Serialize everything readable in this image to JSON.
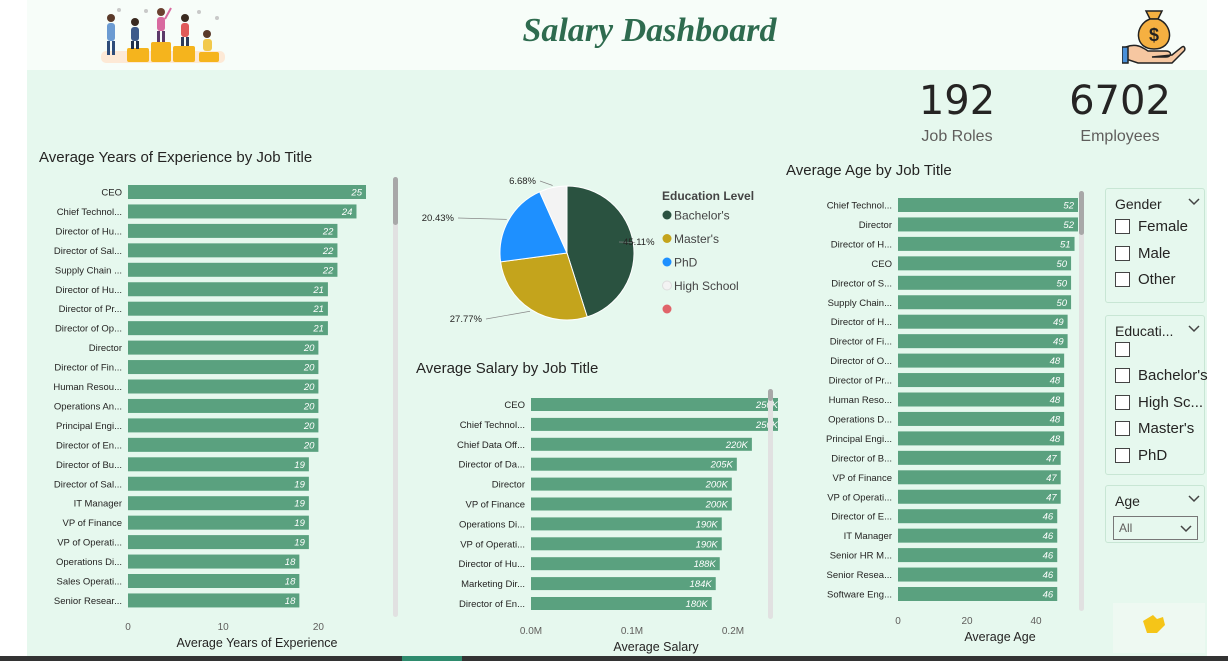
{
  "header": {
    "title": "Salary Dashboard",
    "people_icon": "people-celebrating-icon",
    "money_icon": "money-bag-hand-icon"
  },
  "kpis": [
    {
      "value": "192",
      "label": "Job Roles"
    },
    {
      "value": "6702",
      "label": "Employees"
    }
  ],
  "colors": {
    "bar": "#5aa17f",
    "bachelors": "#2a5240",
    "masters": "#c4a41c",
    "phd": "#1e90ff",
    "high_school": "#f3f3f3",
    "blank": "#e0646a"
  },
  "chart_data": [
    {
      "type": "bar",
      "orientation": "horizontal",
      "title": "Average Years of Experience by Job Title",
      "xlabel": "Average Years of Experience",
      "x_ticks": [
        "0",
        "10",
        "20"
      ],
      "xlim": [
        0,
        25
      ],
      "categories": [
        "CEO",
        "Chief Technol...",
        "Director of Hu...",
        "Director of Sal...",
        "Supply Chain ...",
        "Director of Hu...",
        "Director of Pr...",
        "Director of Op...",
        "Director",
        "Director of Fin...",
        "Human Resou...",
        "Operations An...",
        "Principal Engi...",
        "Director of En...",
        "Director of Bu...",
        "Director of Sal...",
        "IT Manager",
        "VP of Finance",
        "VP of Operati...",
        "Operations Di...",
        "Sales Operati...",
        "Senior Resear..."
      ],
      "values": [
        25,
        24,
        22,
        22,
        22,
        21,
        21,
        21,
        20,
        20,
        20,
        20,
        20,
        20,
        19,
        19,
        19,
        19,
        19,
        18,
        18,
        18
      ],
      "value_labels": [
        "25",
        "24",
        "22",
        "22",
        "22",
        "21",
        "21",
        "21",
        "20",
        "20",
        "20",
        "20",
        "20",
        "20",
        "19",
        "19",
        "19",
        "19",
        "19",
        "18",
        "18",
        "18"
      ]
    },
    {
      "type": "pie",
      "title": "",
      "legend_title": "Education Level",
      "legend_position": "right",
      "labels": [
        "Bachelor's",
        "Master's",
        "PhD",
        "High School",
        ""
      ],
      "values": [
        45.11,
        27.77,
        20.43,
        6.68,
        0
      ],
      "value_labels": [
        "45.11%",
        "27.77%",
        "20.43%",
        "6.68%",
        ""
      ]
    },
    {
      "type": "bar",
      "orientation": "horizontal",
      "title": "Average Salary by Job Title",
      "xlabel": "Average Salary",
      "x_ticks": [
        "0.0M",
        "0.1M",
        "0.2M"
      ],
      "xlim": [
        0,
        250000
      ],
      "categories": [
        "CEO",
        "Chief Technol...",
        "Chief Data Off...",
        "Director of Da...",
        "Director",
        "VP of Finance",
        "Operations Di...",
        "VP of Operati...",
        "Director of Hu...",
        "Marketing Dir...",
        "Director of En..."
      ],
      "values": [
        250000,
        250000,
        220000,
        205000,
        200000,
        200000,
        190000,
        190000,
        188000,
        184000,
        180000
      ],
      "value_labels": [
        "250K",
        "250K",
        "220K",
        "205K",
        "200K",
        "200K",
        "190K",
        "190K",
        "188K",
        "184K",
        "180K"
      ]
    },
    {
      "type": "bar",
      "orientation": "horizontal",
      "title": "Average Age by Job Title",
      "xlabel": "Average Age",
      "x_ticks": [
        "0",
        "20",
        "40"
      ],
      "xlim": [
        0,
        52
      ],
      "categories": [
        "Chief Technol...",
        "Director",
        "Director of H...",
        "CEO",
        "Director of S...",
        "Supply Chain...",
        "Director of H...",
        "Director of Fi...",
        "Director of O...",
        "Director of Pr...",
        "Human Reso...",
        "Operations D...",
        "Principal Engi...",
        "Director of B...",
        "VP of Finance",
        "VP of Operati...",
        "Director of E...",
        "IT Manager",
        "Senior HR M...",
        "Senior Resea...",
        "Software Eng..."
      ],
      "values": [
        52,
        52,
        51,
        50,
        50,
        50,
        49,
        49,
        48,
        48,
        48,
        48,
        48,
        47,
        47,
        47,
        46,
        46,
        46,
        46,
        46
      ],
      "value_labels": [
        "52",
        "52",
        "51",
        "50",
        "50",
        "50",
        "49",
        "49",
        "48",
        "48",
        "48",
        "48",
        "48",
        "47",
        "47",
        "47",
        "46",
        "46",
        "46",
        "46",
        "46"
      ]
    }
  ],
  "slicers": {
    "gender": {
      "title": "Gender",
      "options": [
        "Female",
        "Male",
        "Other"
      ]
    },
    "education": {
      "title": "Educati...",
      "options": [
        "",
        "Bachelor's",
        "High Sc...",
        "Master's",
        "PhD"
      ]
    },
    "age": {
      "title": "Age",
      "selected": "All"
    }
  }
}
